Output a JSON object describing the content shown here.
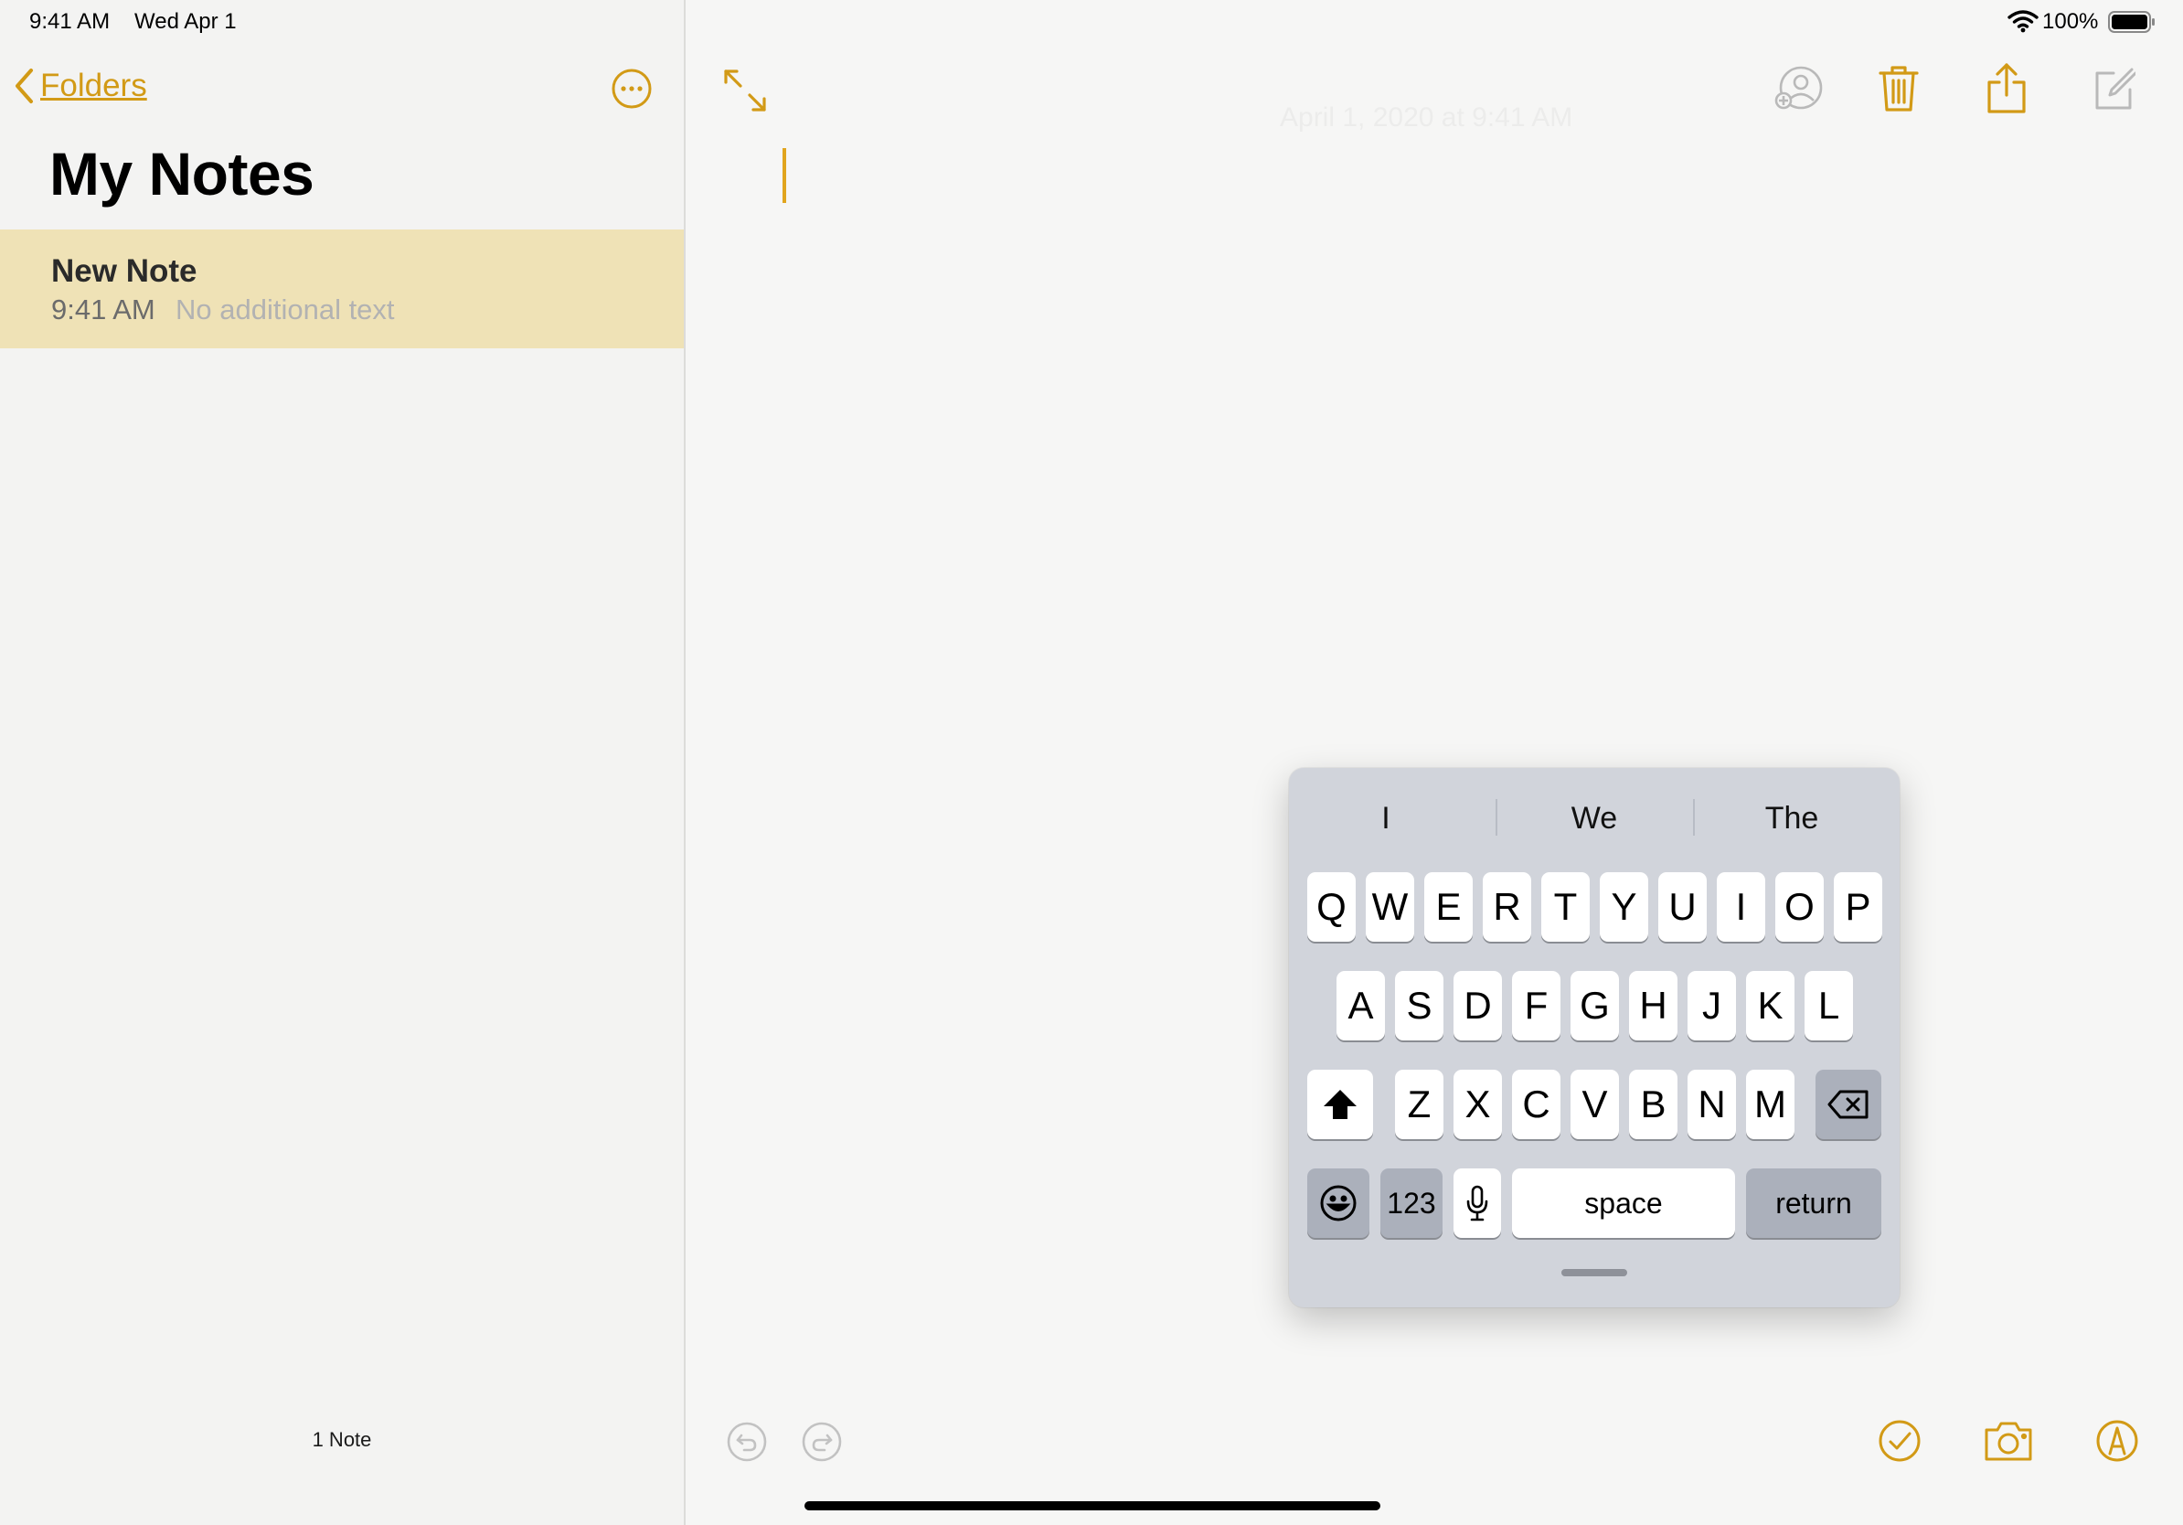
{
  "status_bar": {
    "time": "9:41 AM",
    "date": "Wed Apr 1",
    "battery_percent": "100%",
    "icons": [
      "wifi-icon",
      "battery-icon"
    ]
  },
  "sidebar": {
    "back_label": "Folders",
    "title": "My Notes",
    "notes": [
      {
        "title": "New Note",
        "time": "9:41 AM",
        "preview": "No additional text"
      }
    ],
    "count_label": "1 Note"
  },
  "toolbar": {
    "icons": [
      "expand-icon",
      "add-people-icon",
      "trash-icon",
      "share-icon",
      "compose-icon"
    ]
  },
  "editor": {
    "faded_date": "April 1, 2020 at 9:41 AM"
  },
  "bottom_toolbar": {
    "icons": [
      "undo-icon",
      "redo-icon",
      "checklist-icon",
      "camera-icon",
      "markup-icon"
    ]
  },
  "keyboard": {
    "suggestions": [
      "I",
      "We",
      "The"
    ],
    "row1": [
      "Q",
      "W",
      "E",
      "R",
      "T",
      "Y",
      "U",
      "I",
      "O",
      "P"
    ],
    "row2": [
      "A",
      "S",
      "D",
      "F",
      "G",
      "H",
      "J",
      "K",
      "L"
    ],
    "row3": [
      "Z",
      "X",
      "C",
      "V",
      "B",
      "N",
      "M"
    ],
    "numbers_label": "123",
    "space_label": "space",
    "return_label": "return"
  },
  "colors": {
    "accent": "#d29a16",
    "selection": "#efe2b6",
    "keyboard_bg": "#d1d4db"
  }
}
